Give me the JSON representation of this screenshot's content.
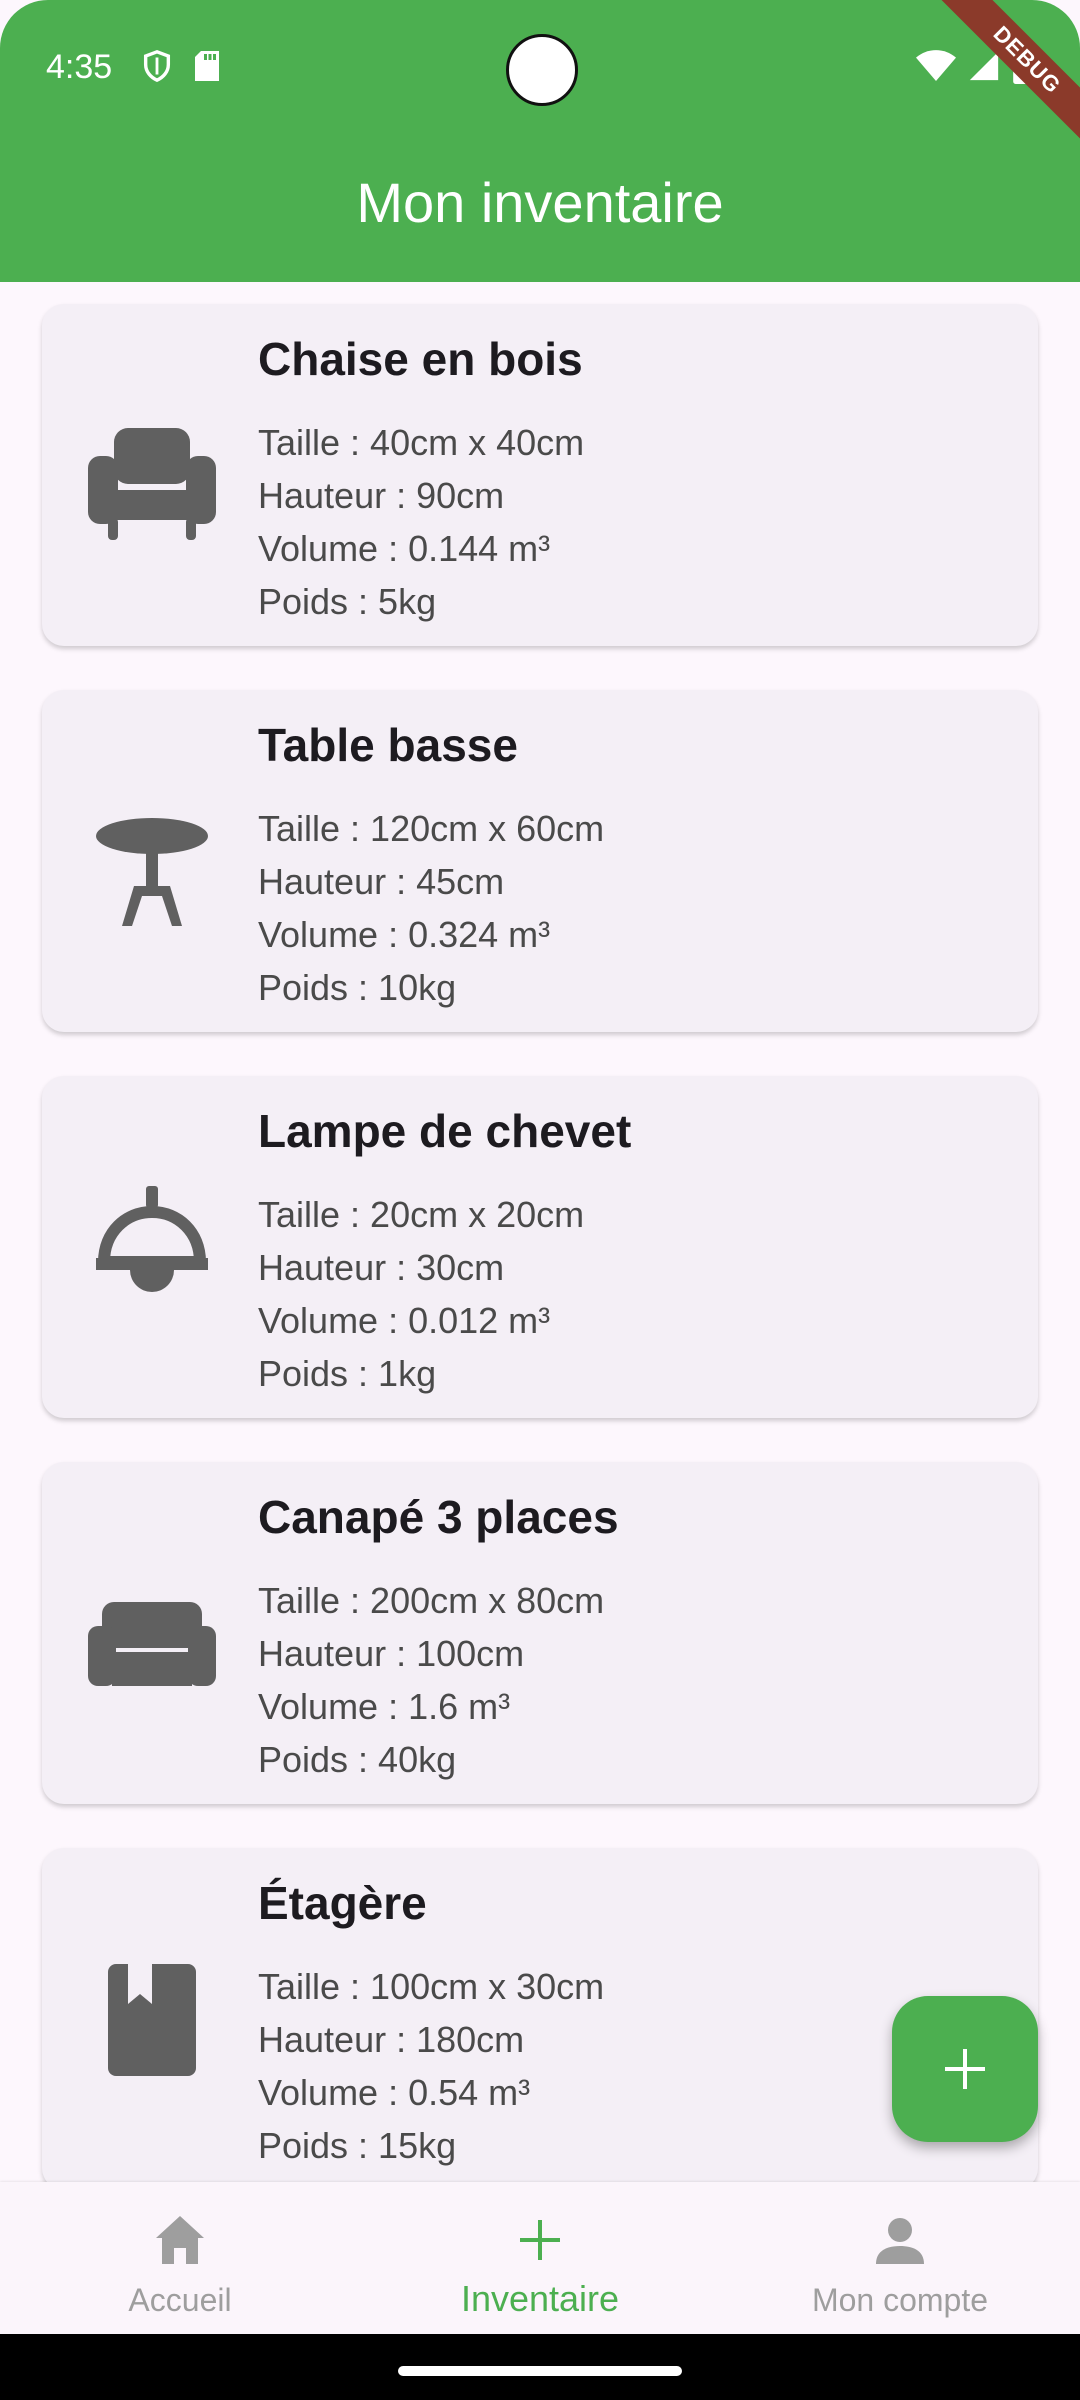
{
  "status_bar": {
    "time": "4:35",
    "debug_label": "DEBUG"
  },
  "app_bar": {
    "title": "Mon inventaire",
    "color": "#4caf50"
  },
  "items": [
    {
      "name": "Chaise en bois",
      "icon": "armchair-icon",
      "lines": [
        "Taille : 40cm x 40cm",
        "Hauteur : 90cm",
        "Volume : 0.144 m³",
        "Poids : 5kg"
      ]
    },
    {
      "name": "Table basse",
      "icon": "table-icon",
      "lines": [
        "Taille : 120cm x 60cm",
        "Hauteur : 45cm",
        "Volume : 0.324 m³",
        "Poids : 10kg"
      ]
    },
    {
      "name": "Lampe de chevet",
      "icon": "lamp-icon",
      "lines": [
        "Taille : 20cm x 20cm",
        "Hauteur : 30cm",
        "Volume : 0.012 m³",
        "Poids : 1kg"
      ]
    },
    {
      "name": "Canapé 3 places",
      "icon": "sofa-icon",
      "lines": [
        "Taille : 200cm x 80cm",
        "Hauteur : 100cm",
        "Volume : 1.6 m³",
        "Poids : 40kg"
      ]
    },
    {
      "name": "Étagère",
      "icon": "book-icon",
      "lines": [
        "Taille : 100cm x 30cm",
        "Hauteur : 180cm",
        "Volume : 0.54 m³",
        "Poids : 15kg"
      ]
    }
  ],
  "fab": {
    "icon": "plus-icon"
  },
  "bottom_nav": [
    {
      "label": "Accueil",
      "icon": "home-icon",
      "active": false
    },
    {
      "label": "Inventaire",
      "icon": "plus-icon",
      "active": true
    },
    {
      "label": "Mon compte",
      "icon": "person-icon",
      "active": false
    }
  ]
}
